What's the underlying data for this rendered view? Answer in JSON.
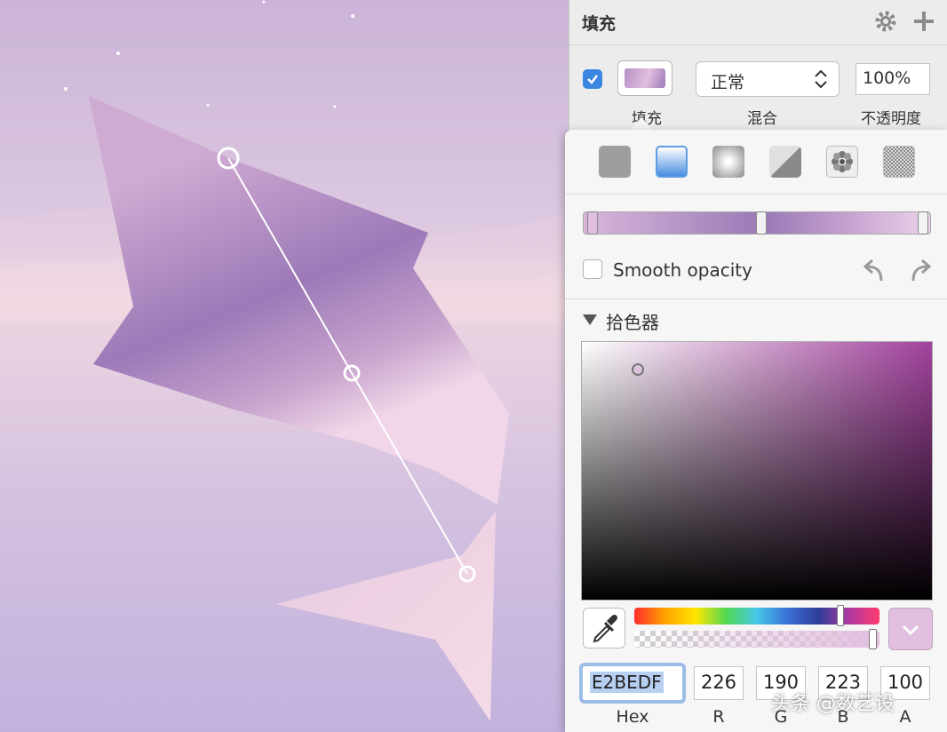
{
  "panel": {
    "title": "填充",
    "blend_value": "正常",
    "opacity_value": "100%",
    "labels": {
      "fill": "填充",
      "blend": "混合",
      "opacity": "不透明度"
    }
  },
  "popover": {
    "fill_types": [
      "solid-fill",
      "linear-gradient",
      "radial-gradient",
      "angular-gradient",
      "pattern-fill",
      "noise-fill"
    ],
    "smooth_opacity_label": "Smooth opacity",
    "picker_title": "拾色器",
    "hex_value": "E2BEDF",
    "rgba": [
      {
        "value": "226",
        "label": "R"
      },
      {
        "value": "190",
        "label": "G"
      },
      {
        "value": "223",
        "label": "B"
      },
      {
        "value": "100",
        "label": "A"
      }
    ],
    "hex_label": "Hex"
  },
  "watermark": "头条 @数艺设",
  "colors": {
    "selected": "#e2bedf",
    "accent": "#3a86e0"
  }
}
